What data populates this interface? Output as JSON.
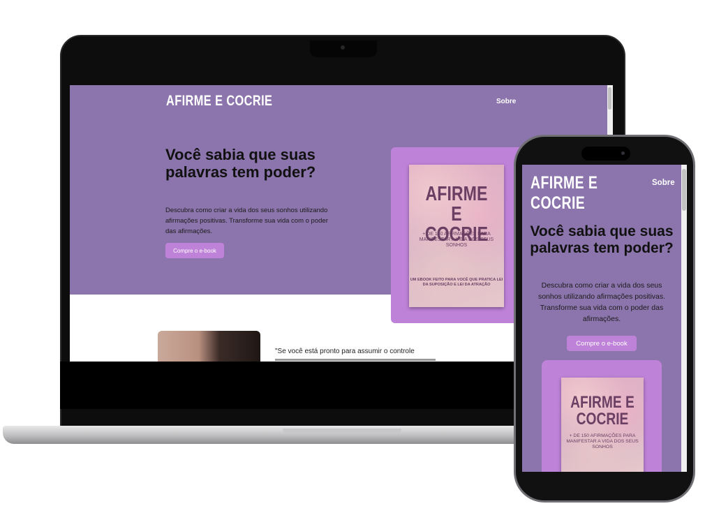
{
  "site": {
    "brand": "AFIRME E COCRIE",
    "nav_link": "Sobre",
    "hero_title": "Você sabia que suas palavras tem poder?",
    "hero_description": "Descubra como criar a vida dos seus sonhos utilizando afirmações positivas. Transforme sua vida com o poder das afirmações.",
    "cta_label": "Compre o e-book"
  },
  "ebook": {
    "title": "AFIRME E COCRIE",
    "subtitle": "+ DE 150 AFIRMAÇÕES PARA MANIFESTAR A VIDA DOS SEUS SONHOS",
    "footer": "UM EBOOK FEITO PARA VOCÊ QUE PRATICA LEI DA SUPOSIÇÃO E LEI DA ATRAÇÃO"
  },
  "testimonial": {
    "quote_start": "\"Se você está pronto para assumir o controle"
  },
  "colors": {
    "hero_bg": "#8c74ac",
    "accent": "#be82d8",
    "ebook_text": "#6a3f63"
  }
}
